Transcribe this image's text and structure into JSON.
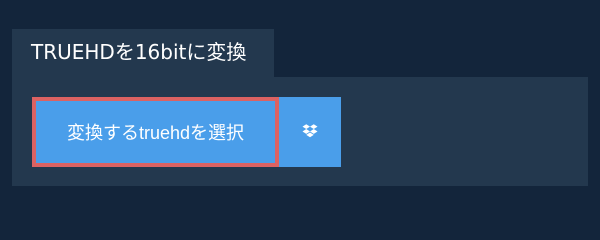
{
  "tab": {
    "title": "TRUEHDを16bitに変換"
  },
  "actions": {
    "select_label": "変換するtruehdを選択",
    "dropbox_icon": "dropbox-icon"
  },
  "colors": {
    "page_background": "#13253b",
    "panel_background": "#23384e",
    "button_blue": "#4a9eea",
    "highlight_border": "#dc6262"
  }
}
